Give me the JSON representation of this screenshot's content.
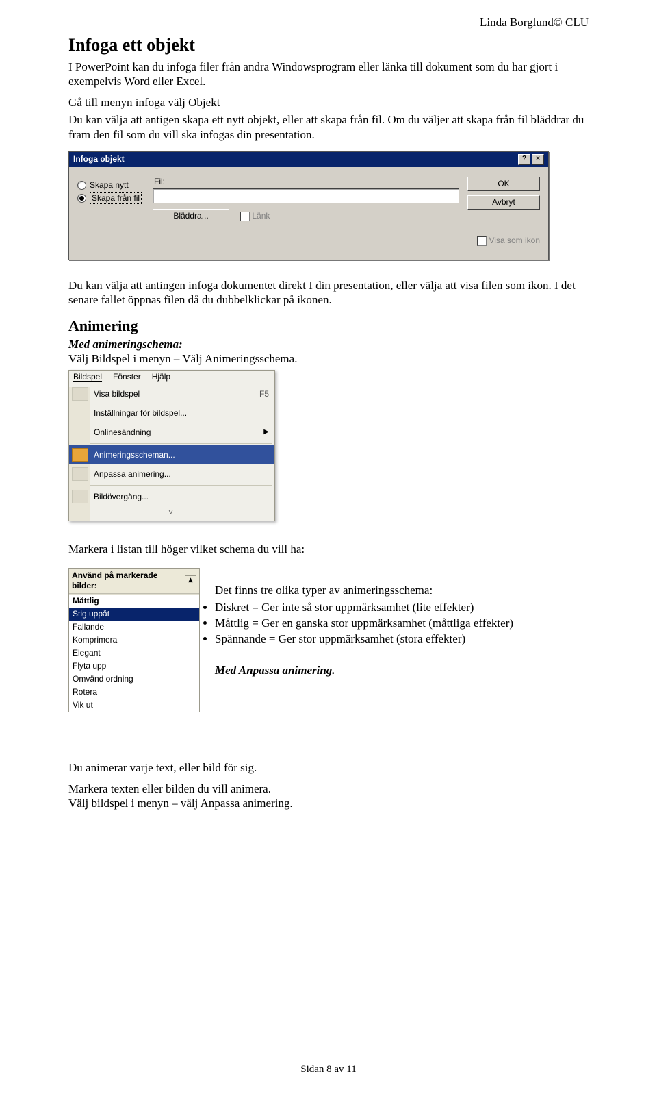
{
  "header": {
    "right": "Linda Borglund© CLU"
  },
  "section1": {
    "title": "Infoga ett objekt",
    "p1": "I PowerPoint kan du infoga filer från andra Windowsprogram eller länka till dokument som du har gjort i exempelvis Word eller Excel.",
    "p2": "Gå till menyn infoga välj Objekt",
    "p3": "Du kan välja att antigen skapa ett nytt objekt, eller att skapa från fil. Om du väljer att skapa från fil bläddrar du fram den fil som du vill ska infogas din presentation."
  },
  "dlg": {
    "title": "Infoga objekt",
    "radio_new": "Skapa nytt",
    "radio_from_file": "Skapa från fil",
    "fil_label": "Fil:",
    "browse": "Bläddra...",
    "link": "Länk",
    "ok": "OK",
    "cancel": "Avbryt",
    "as_icon": "Visa som ikon",
    "help_btn": "?",
    "close_btn": "×"
  },
  "after_dlg": "Du kan välja att antingen infoga dokumentet direkt I din presentation, eller välja att visa filen som ikon. I det senare fallet öppnas filen då du dubbelklickar på ikonen.",
  "section2": {
    "title": "Animering",
    "sub1": "Med animeringschema:",
    "line1": "Välj Bildspel i menyn – Välj Animeringsschema."
  },
  "menu": {
    "top": [
      "Bildspel",
      "Fönster",
      "Hjälp"
    ],
    "items": [
      {
        "label": "Visa bildspel",
        "shortcut": "F5",
        "icon": true
      },
      {
        "label": "Inställningar för bildspel..."
      },
      {
        "label": "Onlinesändning",
        "arrow": "▶"
      },
      {
        "label": "Animeringsscheman...",
        "icon": true,
        "highlight": true
      },
      {
        "label": "Anpassa animering...",
        "icon": true
      },
      {
        "label": "Bildövergång...",
        "icon": true
      }
    ],
    "expand": "˅"
  },
  "after_menu": "Markera i listan till höger vilket schema du vill ha:",
  "anim_list": {
    "head": "Använd på markerade bilder:",
    "items": [
      {
        "label": "Måttlig",
        "cat": true
      },
      {
        "label": "Stig uppåt",
        "sel": true
      },
      {
        "label": "Fallande"
      },
      {
        "label": "Komprimera"
      },
      {
        "label": "Elegant"
      },
      {
        "label": "Flyta upp"
      },
      {
        "label": "Omvänd ordning"
      },
      {
        "label": "Rotera"
      },
      {
        "label": "Vik ut"
      }
    ],
    "scroll_up": "▴"
  },
  "bullets": {
    "intro": "Det finns tre olika typer av animeringsschema:",
    "items": [
      "Diskret = Ger inte så stor uppmärksamhet (lite effekter)",
      "Måttlig = Ger en ganska stor uppmärksamhet (måttliga effekter)",
      "Spännande = Ger stor uppmärksamhet (stora effekter)"
    ],
    "sub2": "Med Anpassa animering."
  },
  "tail": {
    "t1": "Du animerar varje text, eller bild för sig.",
    "t2": "Markera texten eller bilden du vill animera.",
    "t3": "Välj bildspel i menyn – välj Anpassa animering."
  },
  "footer": "Sidan 8 av 11"
}
